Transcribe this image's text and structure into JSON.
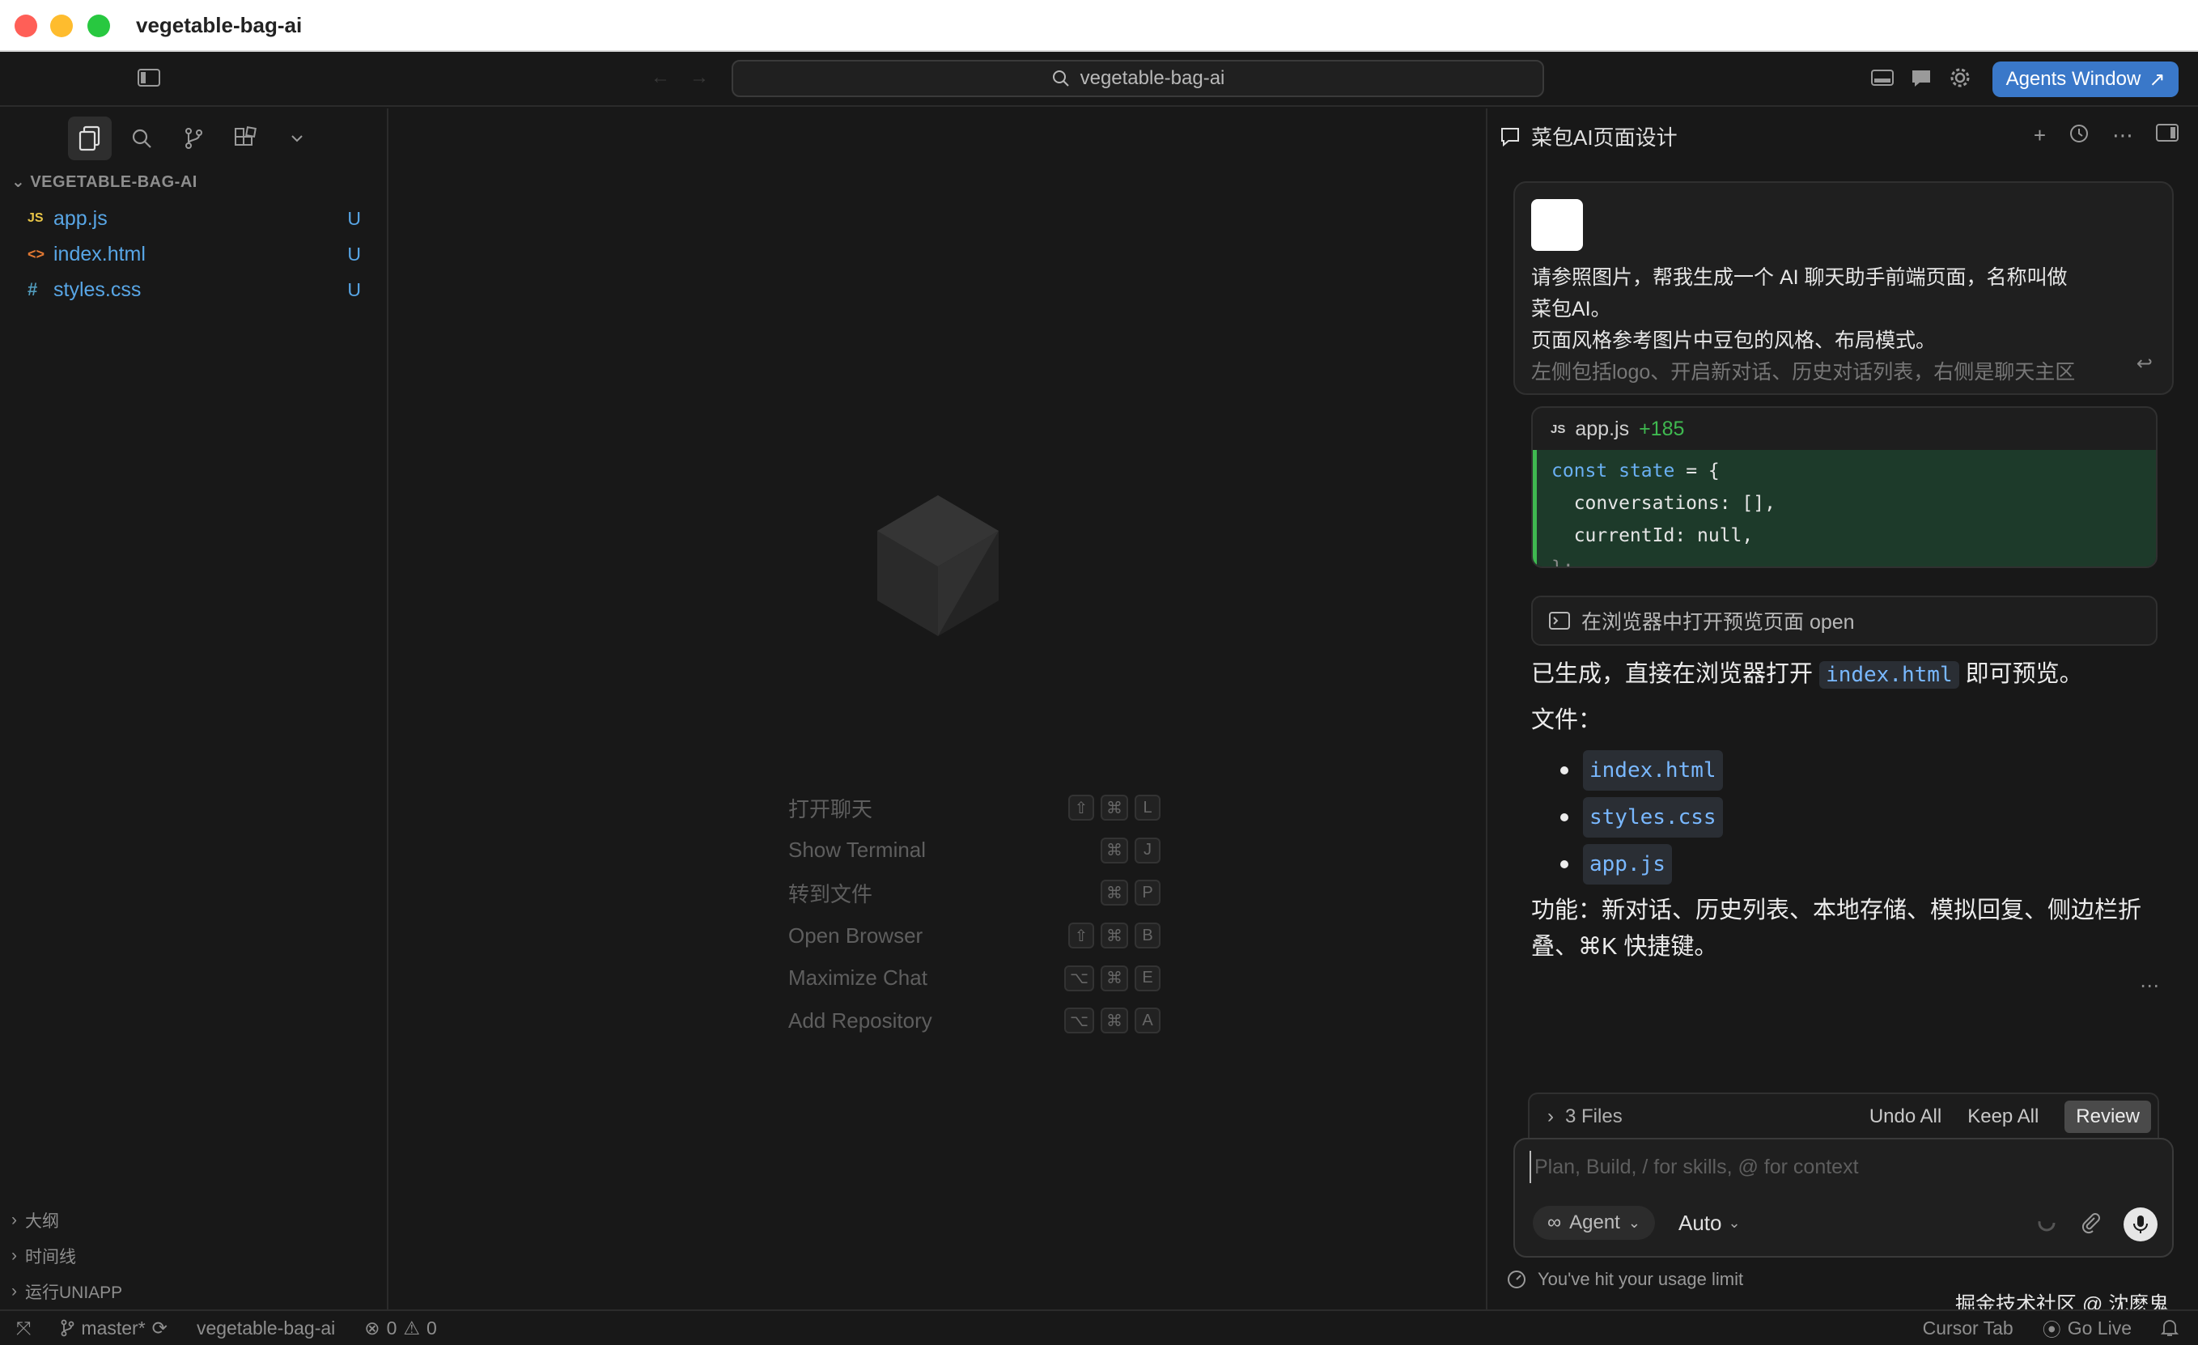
{
  "window": {
    "title": "vegetable-bag-ai"
  },
  "toolbar": {
    "search_text": "vegetable-bag-ai",
    "agents_window_label": "Agents Window"
  },
  "sidebar": {
    "project": "VEGETABLE-BAG-AI",
    "files": [
      {
        "name": "app.js",
        "icon": "JS",
        "status": "U",
        "icon_color": "#e8c547"
      },
      {
        "name": "index.html",
        "icon": "<>",
        "status": "U",
        "icon_color": "#e37933"
      },
      {
        "name": "styles.css",
        "icon": "#",
        "status": "U",
        "icon_color": "#519aba"
      }
    ],
    "sections": [
      "大纲",
      "时间线",
      "运行UNIAPP"
    ]
  },
  "welcome": {
    "shortcuts": [
      {
        "label": "打开聊天",
        "keys": [
          "⇧",
          "⌘",
          "L"
        ]
      },
      {
        "label": "Show Terminal",
        "keys": [
          "",
          "⌘",
          "J"
        ]
      },
      {
        "label": "转到文件",
        "keys": [
          "",
          "⌘",
          "P"
        ]
      },
      {
        "label": "Open Browser",
        "keys": [
          "⇧",
          "⌘",
          "B"
        ]
      },
      {
        "label": "Maximize Chat",
        "keys": [
          "⌥",
          "⌘",
          "E"
        ]
      },
      {
        "label": "Add Repository",
        "keys": [
          "⌥",
          "⌘",
          "A"
        ]
      }
    ]
  },
  "chat": {
    "tab_title": "菜包AI页面设计",
    "user_message": {
      "line1": "请参照图片，帮我生成一个 AI 聊天助手前端页面，名称叫做",
      "line2": "菜包AI。",
      "line3": "页面风格参考图片中豆包的风格、布局模式。",
      "line4": "左侧包括logo、开启新对话、历史对话列表，右侧是聊天主区"
    },
    "code_card": {
      "badge": "JS",
      "filename": "app.js",
      "additions": "+185",
      "lines": [
        "const state = {",
        "  conversations: [],",
        "  currentId: null,",
        "};"
      ]
    },
    "tool_call": "在浏览器中打开预览页面 open",
    "answer": {
      "intro_before": "已生成，直接在浏览器打开 ",
      "intro_code": "index.html",
      "intro_after": " 即可预览。",
      "files_label": "文件：",
      "files": [
        "index.html",
        "styles.css",
        "app.js"
      ],
      "features": "功能：新对话、历史列表、本地存储、模拟回复、侧边栏折叠、⌘K 快捷键。"
    },
    "files_bar": {
      "count_label": "3 Files",
      "undo_all": "Undo All",
      "keep_all": "Keep All",
      "review": "Review"
    },
    "composer": {
      "placeholder": "Plan, Build, / for skills, @ for context",
      "agent_label": "Agent",
      "model_label": "Auto"
    },
    "usage_notice": "You've hit your usage limit"
  },
  "watermark": "掘金技术社区 @ 沈麽鬼",
  "statusbar": {
    "branch": "master*",
    "project": "vegetable-bag-ai",
    "errors": "0",
    "warnings": "0",
    "cursor_tab": "Cursor Tab",
    "go_live": "Go Live"
  },
  "colors": {
    "accent": "#3a78c9",
    "added_green": "#3fb950",
    "file_blue": "#58a6e6"
  }
}
